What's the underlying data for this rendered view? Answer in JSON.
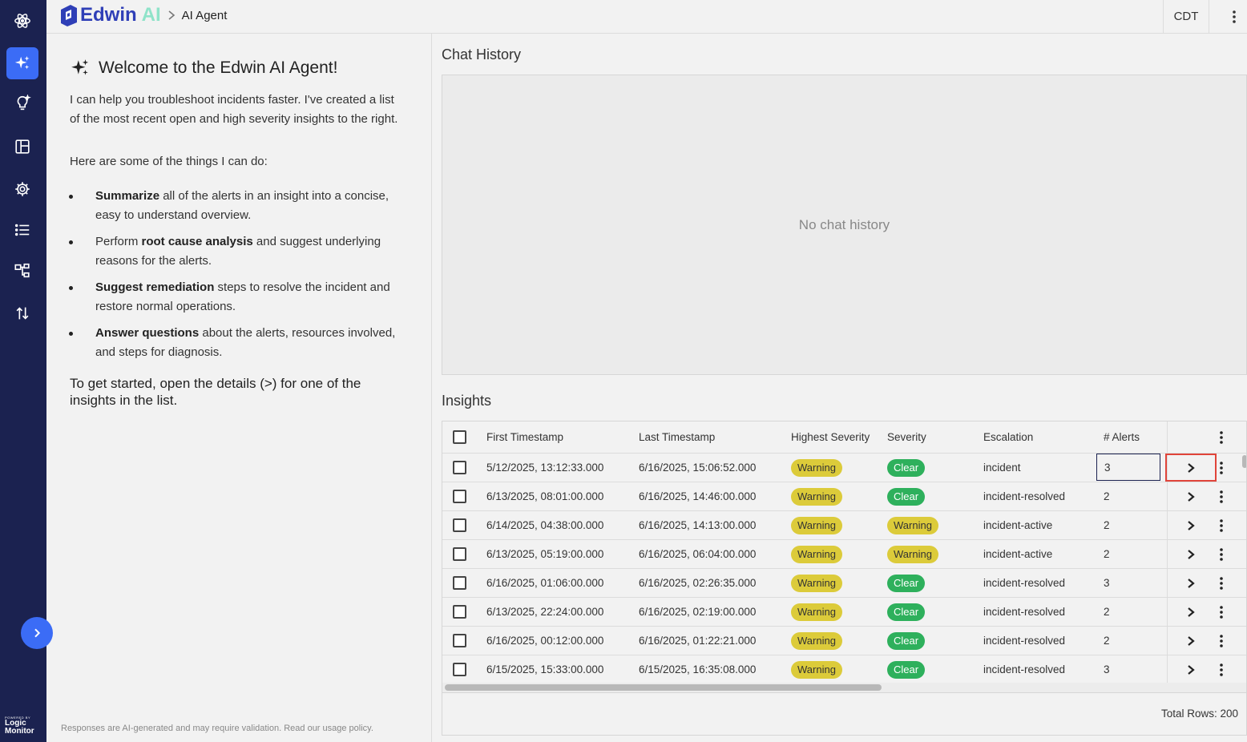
{
  "header": {
    "brand_name": "Edwin",
    "brand_ai": "AI",
    "breadcrumb": "AI Agent",
    "timezone": "CDT"
  },
  "rail": {
    "items": [
      "atom-icon",
      "sparkles-icon",
      "lightbulb-icon",
      "dashboard-icon",
      "settings-gear-icon",
      "list-icon",
      "topology-icon",
      "sort-arrows-icon"
    ],
    "active": "sparkles-icon",
    "logo_tiny": "POWERED BY",
    "logo_line1": "Logic",
    "logo_line2": "Monitor"
  },
  "welcome": {
    "title": "Welcome to the Edwin AI Agent!",
    "intro": "I can help you troubleshoot incidents faster. I've created a list of the most recent open and high severity insights to the right.",
    "intro2": "Here are some of the things I can do:",
    "capabilities": [
      {
        "bold": "Summarize",
        "rest": " all of the alerts in an insight into a concise, easy to understand overview."
      },
      {
        "pre": "Perform ",
        "bold": "root cause analysis",
        "rest": " and suggest underlying reasons for the alerts."
      },
      {
        "bold": "Suggest remediation",
        "rest": " steps to resolve the incident and restore normal operations."
      },
      {
        "bold": "Answer questions",
        "rest": " about the alerts, resources involved, and steps for diagnosis."
      }
    ],
    "get_started": "To get started, open the details (>) for one of the insights in the list.",
    "footer": "Responses are AI-generated and may require validation. Read our usage policy."
  },
  "chat": {
    "title": "Chat History",
    "empty": "No chat history"
  },
  "insights": {
    "title": "Insights",
    "columns": [
      "First Timestamp",
      "Last Timestamp",
      "Highest Severity",
      "Severity",
      "Escalation",
      "# Alerts"
    ],
    "rows": [
      {
        "first": "5/12/2025, 13:12:33.000",
        "last": "6/16/2025, 15:06:52.000",
        "highest": "Warning",
        "severity": "Clear",
        "escalation": "incident",
        "alerts": "3"
      },
      {
        "first": "6/13/2025, 08:01:00.000",
        "last": "6/16/2025, 14:46:00.000",
        "highest": "Warning",
        "severity": "Clear",
        "escalation": "incident-resolved",
        "alerts": "2"
      },
      {
        "first": "6/14/2025, 04:38:00.000",
        "last": "6/16/2025, 14:13:00.000",
        "highest": "Warning",
        "severity": "Warning",
        "escalation": "incident-active",
        "alerts": "2"
      },
      {
        "first": "6/13/2025, 05:19:00.000",
        "last": "6/16/2025, 06:04:00.000",
        "highest": "Warning",
        "severity": "Warning",
        "escalation": "incident-active",
        "alerts": "2"
      },
      {
        "first": "6/16/2025, 01:06:00.000",
        "last": "6/16/2025, 02:26:35.000",
        "highest": "Warning",
        "severity": "Clear",
        "escalation": "incident-resolved",
        "alerts": "3"
      },
      {
        "first": "6/13/2025, 22:24:00.000",
        "last": "6/16/2025, 02:19:00.000",
        "highest": "Warning",
        "severity": "Clear",
        "escalation": "incident-resolved",
        "alerts": "2"
      },
      {
        "first": "6/16/2025, 00:12:00.000",
        "last": "6/16/2025, 01:22:21.000",
        "highest": "Warning",
        "severity": "Clear",
        "escalation": "incident-resolved",
        "alerts": "2"
      },
      {
        "first": "6/15/2025, 15:33:00.000",
        "last": "6/15/2025, 16:35:08.000",
        "highest": "Warning",
        "severity": "Clear",
        "escalation": "incident-resolved",
        "alerts": "3"
      }
    ],
    "total_rows": "Total Rows: 200",
    "colors": {
      "warning": "#dccb3a",
      "clear": "#2eb05c"
    }
  }
}
